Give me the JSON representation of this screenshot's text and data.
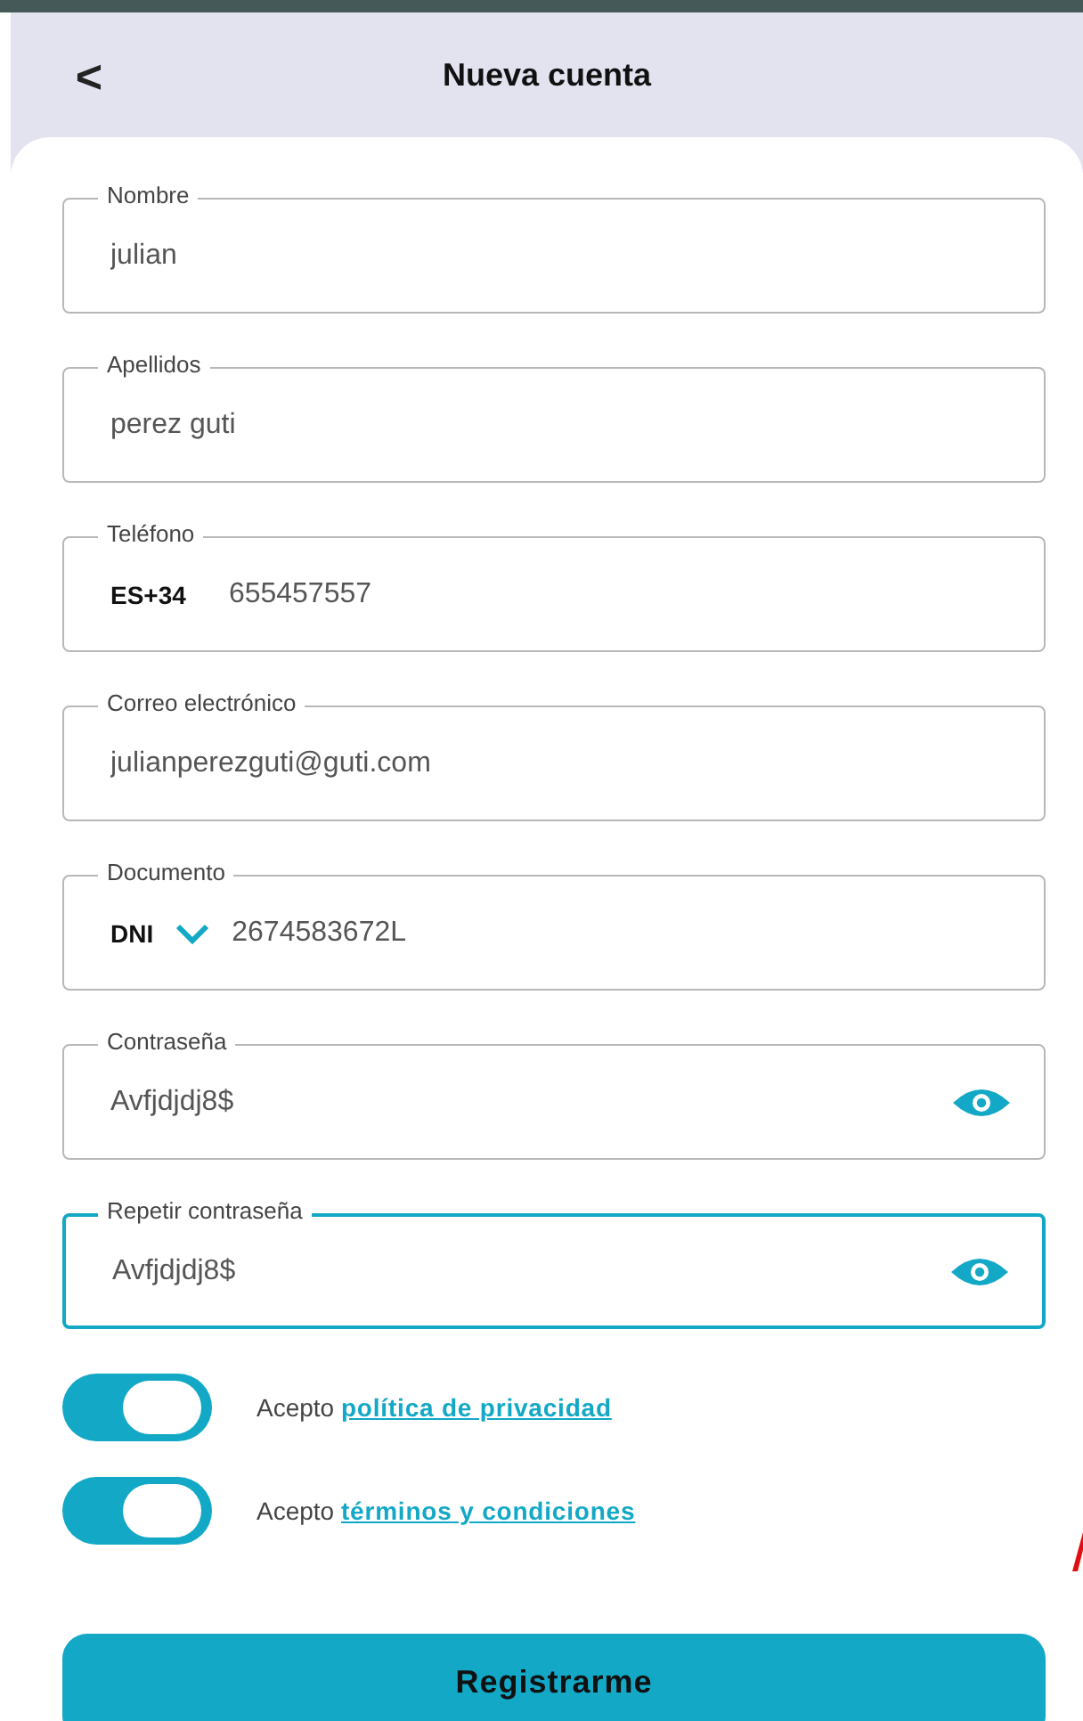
{
  "header": {
    "back": "<",
    "title": "Nueva cuenta"
  },
  "fields": [
    {
      "kind": "text",
      "label": "Nombre",
      "value": "julian",
      "focused": false
    },
    {
      "kind": "text",
      "label": "Apellidos",
      "value": "perez guti",
      "focused": false
    },
    {
      "kind": "phone",
      "label": "Teléfono",
      "prefix": "ES+34",
      "value": "655457557",
      "focused": false
    },
    {
      "kind": "text",
      "label": "Correo electrónico",
      "value": "julianperezguti@guti.com",
      "focused": false
    },
    {
      "kind": "document",
      "label": "Documento",
      "prefix": "DNI",
      "value": "2674583672L",
      "focused": false
    },
    {
      "kind": "password",
      "label": "Contraseña",
      "value": "Avfjdjdj8$",
      "focused": false
    },
    {
      "kind": "password",
      "label": "Repetir contraseña",
      "value": "Avfjdjdj8$",
      "focused": true
    }
  ],
  "consents": [
    {
      "text": "Acepto",
      "link": "política de privacidad",
      "on": true
    },
    {
      "text": "Acepto",
      "link": "términos y condiciones",
      "on": true
    }
  ],
  "submit": "Registrarme"
}
